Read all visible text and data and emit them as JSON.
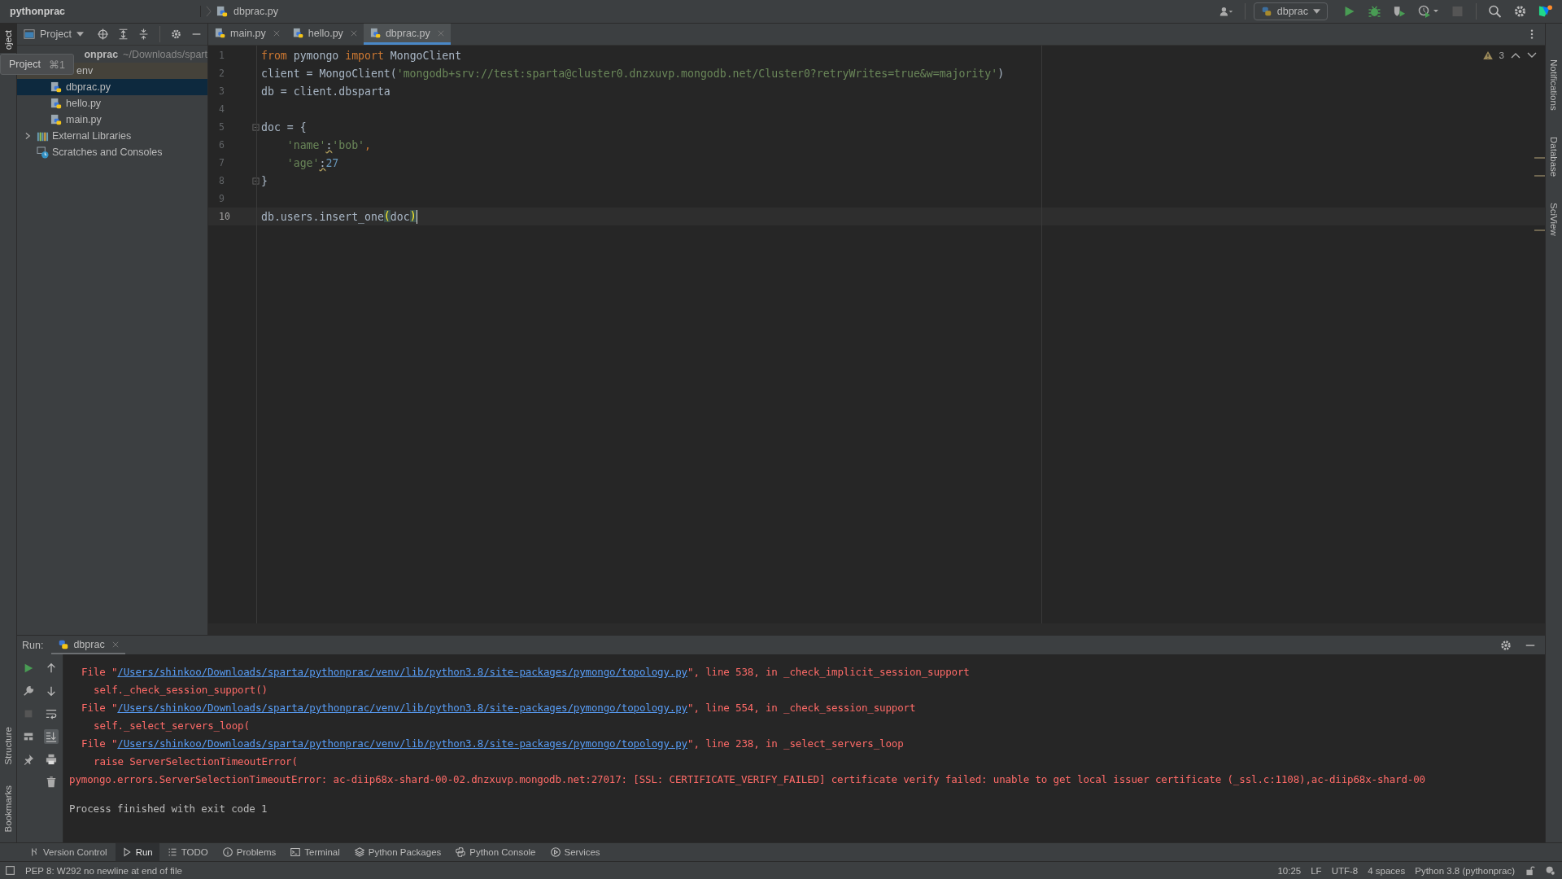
{
  "title_bar": {
    "breadcrumbs": [
      {
        "label": "pythonprac",
        "kind": "project"
      },
      {
        "label": "dbprac.py",
        "kind": "file"
      }
    ],
    "run_config": "dbprac"
  },
  "left_stripe": {
    "top": [
      "oject"
    ],
    "bottom": [
      "Structure",
      "Bookmarks"
    ]
  },
  "right_stripe": [
    "Notifications",
    "Database",
    "SciView"
  ],
  "project_panel": {
    "title": "Project",
    "tooltip": {
      "label": "Project",
      "shortcut": "⌘1"
    },
    "tree": [
      {
        "label": "onprac",
        "path": "~/Downloads/spart",
        "kind": "project",
        "selected": false,
        "children": [
          {
            "label": "env",
            "kind": "folder",
            "selected": false
          },
          {
            "label": "dbprac.py",
            "kind": "file",
            "selected": true
          },
          {
            "label": "hello.py",
            "kind": "file",
            "selected": false
          },
          {
            "label": "main.py",
            "kind": "file",
            "selected": false
          }
        ]
      },
      {
        "label": "External Libraries",
        "kind": "library",
        "selected": false,
        "expanded": false
      },
      {
        "label": "Scratches and Consoles",
        "kind": "scratches",
        "selected": false
      }
    ]
  },
  "editor": {
    "tabs": [
      {
        "label": "main.py",
        "selected": false
      },
      {
        "label": "hello.py",
        "selected": false
      },
      {
        "label": "dbprac.py",
        "selected": true
      }
    ],
    "warnings": "3",
    "lines": [
      {
        "number": "1",
        "current": false,
        "tokens": [
          {
            "text": "from",
            "kind": "kw"
          },
          {
            "text": " pymongo ",
            "kind": "plain"
          },
          {
            "text": "import",
            "kind": "kw"
          },
          {
            "text": " MongoClient",
            "kind": "plain"
          }
        ]
      },
      {
        "number": "2",
        "current": false,
        "tokens": [
          {
            "text": "client = MongoClient(",
            "kind": "plain"
          },
          {
            "text": "'mongodb+srv://test:sparta@cluster0.dnzxuvp.mongodb.net/Cluster0?retryWrites=true&w=majority'",
            "kind": "str"
          },
          {
            "text": ")",
            "kind": "plain"
          }
        ]
      },
      {
        "number": "3",
        "current": false,
        "tokens": [
          {
            "text": "db = client.dbsparta",
            "kind": "plain"
          }
        ]
      },
      {
        "number": "4",
        "current": false
      },
      {
        "number": "5",
        "current": false,
        "fold": true,
        "tokens": [
          {
            "text": "doc = {",
            "kind": "plain"
          }
        ]
      },
      {
        "number": "6",
        "current": false,
        "tokens": [
          {
            "text": "    'name'",
            "kind": "str"
          },
          {
            "text": ":",
            "kind": "warn"
          },
          {
            "text": "'bob'",
            "kind": "str"
          },
          {
            "text": ",",
            "kind": "kw"
          }
        ]
      },
      {
        "number": "7",
        "current": false,
        "tokens": [
          {
            "text": "    'age'",
            "kind": "str"
          },
          {
            "text": ":",
            "kind": "warn"
          },
          {
            "text": "27",
            "kind": "num"
          }
        ]
      },
      {
        "number": "8",
        "current": false,
        "fold": true,
        "tokens": [
          {
            "text": "}",
            "kind": "plain"
          }
        ]
      },
      {
        "number": "9",
        "current": false
      },
      {
        "number": "10",
        "current": true,
        "tokens": [
          {
            "text": "db.users.insert_one",
            "kind": "plain"
          },
          {
            "text": "(",
            "kind": "brace"
          },
          {
            "text": "doc",
            "kind": "plain"
          },
          {
            "text": ")",
            "kind": "brace"
          }
        ]
      }
    ]
  },
  "run_panel": {
    "label": "Run:",
    "tab": "dbprac",
    "lines": [
      {
        "kind": "file",
        "prefix": "File \"",
        "link": "/Users/shinkoo/Downloads/sparta/pythonprac/venv/lib/python3.8/site-packages/pymongo/topology.py",
        "suffix": "\", line 538, in _check_implicit_session_support"
      },
      {
        "kind": "code",
        "text": "self._check_session_support()"
      },
      {
        "kind": "file",
        "prefix": "File \"",
        "link": "/Users/shinkoo/Downloads/sparta/pythonprac/venv/lib/python3.8/site-packages/pymongo/topology.py",
        "suffix": "\", line 554, in _check_session_support"
      },
      {
        "kind": "code",
        "text": "self._select_servers_loop("
      },
      {
        "kind": "file",
        "prefix": "File \"",
        "link": "/Users/shinkoo/Downloads/sparta/pythonprac/venv/lib/python3.8/site-packages/pymongo/topology.py",
        "suffix": "\", line 238, in _select_servers_loop"
      },
      {
        "kind": "code",
        "text": "raise ServerSelectionTimeoutError("
      },
      {
        "kind": "error",
        "text": "pymongo.errors.ServerSelectionTimeoutError: ac-diip68x-shard-00-02.dnzxuvp.mongodb.net:27017: [SSL: CERTIFICATE_VERIFY_FAILED] certificate verify failed: unable to get local issuer certificate (_ssl.c:1108),ac-diip68x-shard-00"
      },
      {
        "kind": "info",
        "text": "Process finished with exit code 1"
      }
    ]
  },
  "tool_tabs": [
    {
      "label": "Version Control",
      "selected": false
    },
    {
      "label": "Run",
      "selected": true
    },
    {
      "label": "TODO",
      "selected": false
    },
    {
      "label": "Problems",
      "selected": false
    },
    {
      "label": "Terminal",
      "selected": false
    },
    {
      "label": "Python Packages",
      "selected": false
    },
    {
      "label": "Python Console",
      "selected": false
    },
    {
      "label": "Services",
      "selected": false
    }
  ],
  "status_bar": {
    "message": "PEP 8: W292 no newline at end of file",
    "items": [
      "10:25",
      "LF",
      "UTF-8",
      "4 spaces",
      "Python 3.8 (pythonprac)"
    ]
  }
}
